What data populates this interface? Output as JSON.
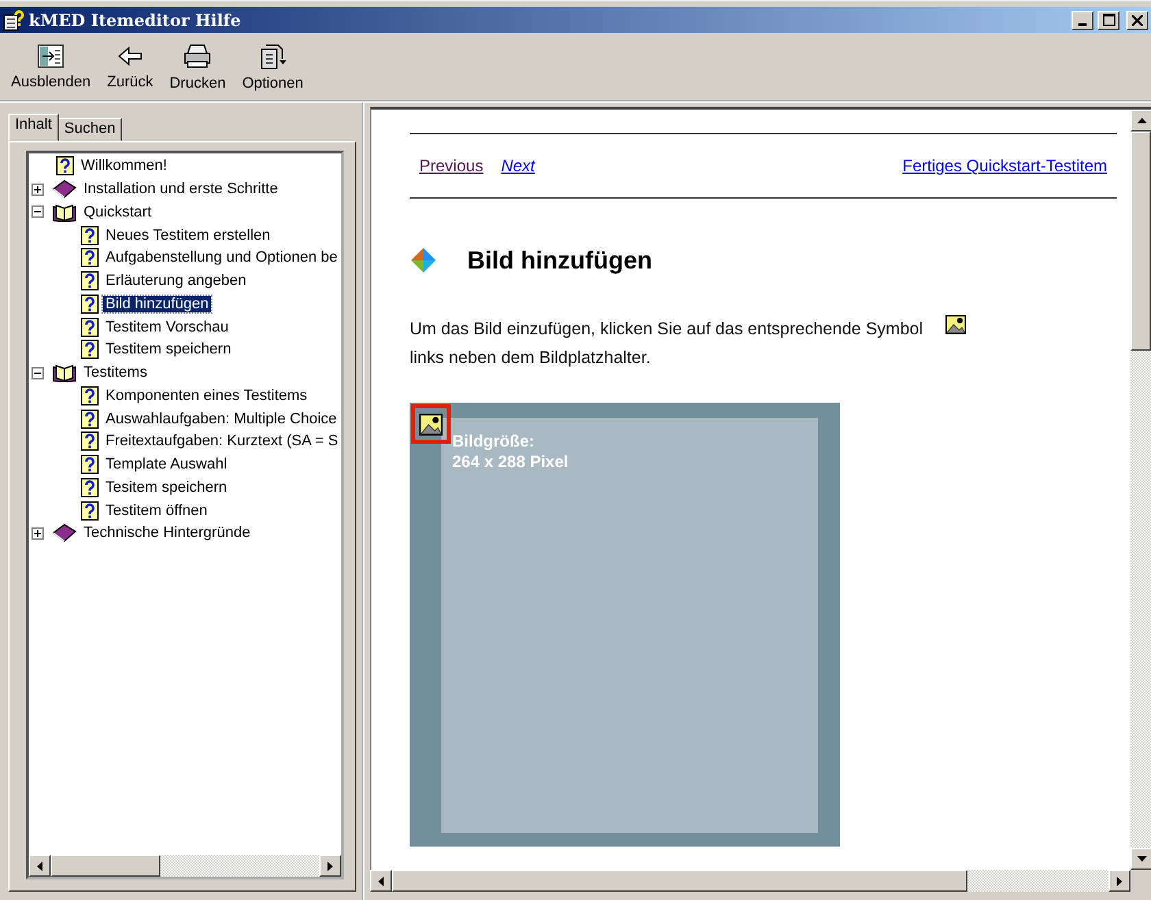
{
  "window": {
    "title": "kMED Itemeditor Hilfe"
  },
  "toolbar": [
    {
      "label": "Ausblenden",
      "kind": "hide"
    },
    {
      "label": "Zurück",
      "kind": "back"
    },
    {
      "label": "Drucken",
      "kind": "print"
    },
    {
      "label": "Optionen",
      "kind": "options"
    }
  ],
  "tabs": [
    {
      "label": "Inhalt",
      "selected": true
    },
    {
      "label": "Suchen",
      "selected": false
    }
  ],
  "tree": [
    {
      "label": "Willkommen!",
      "kind": "page",
      "selected": false
    },
    {
      "label": "Installation und erste Schritte",
      "kind": "book",
      "expanded": false,
      "selected": false
    },
    {
      "label": "Quickstart",
      "kind": "book",
      "expanded": true,
      "selected": false,
      "children": [
        {
          "label": "Neues Testitem erstellen",
          "kind": "page",
          "selected": false
        },
        {
          "label": "Aufgabenstellung und Optionen be",
          "kind": "page",
          "selected": false
        },
        {
          "label": "Erläuterung angeben",
          "kind": "page",
          "selected": false
        },
        {
          "label": "Bild hinzufügen",
          "kind": "page",
          "selected": true
        },
        {
          "label": "Testitem Vorschau",
          "kind": "page",
          "selected": false
        },
        {
          "label": "Testitem speichern",
          "kind": "page",
          "selected": false
        }
      ]
    },
    {
      "label": "Testitems",
      "kind": "book",
      "expanded": true,
      "selected": false,
      "children": [
        {
          "label": "Komponenten eines Testitems",
          "kind": "page",
          "selected": false
        },
        {
          "label": "Auswahlaufgaben: Multiple Choice",
          "kind": "page",
          "selected": false
        },
        {
          "label": "Freitextaufgaben: Kurztext (SA = S",
          "kind": "page",
          "selected": false
        },
        {
          "label": "Template Auswahl",
          "kind": "page",
          "selected": false
        },
        {
          "label": "Tesitem speichern",
          "kind": "page",
          "selected": false
        },
        {
          "label": "Testitem öffnen",
          "kind": "page",
          "selected": false
        }
      ]
    },
    {
      "label": "Technische Hintergründe",
      "kind": "book",
      "expanded": false,
      "selected": false
    }
  ],
  "content": {
    "nav": [
      {
        "label": "Previous",
        "visited": true
      },
      {
        "label": "Next",
        "visited": false
      }
    ],
    "next_topic": "Fertiges Quickstart-Testitem",
    "heading": "Bild hinzufügen",
    "paragraph_lines": [
      "Um das Bild einzufügen, klicken Sie auf das entsprechende Symbol",
      "links neben dem Bildplatzhalter."
    ],
    "placeholder": {
      "caption_lines": [
        "Bildgröße:",
        "264 x 288 Pixel"
      ]
    }
  }
}
